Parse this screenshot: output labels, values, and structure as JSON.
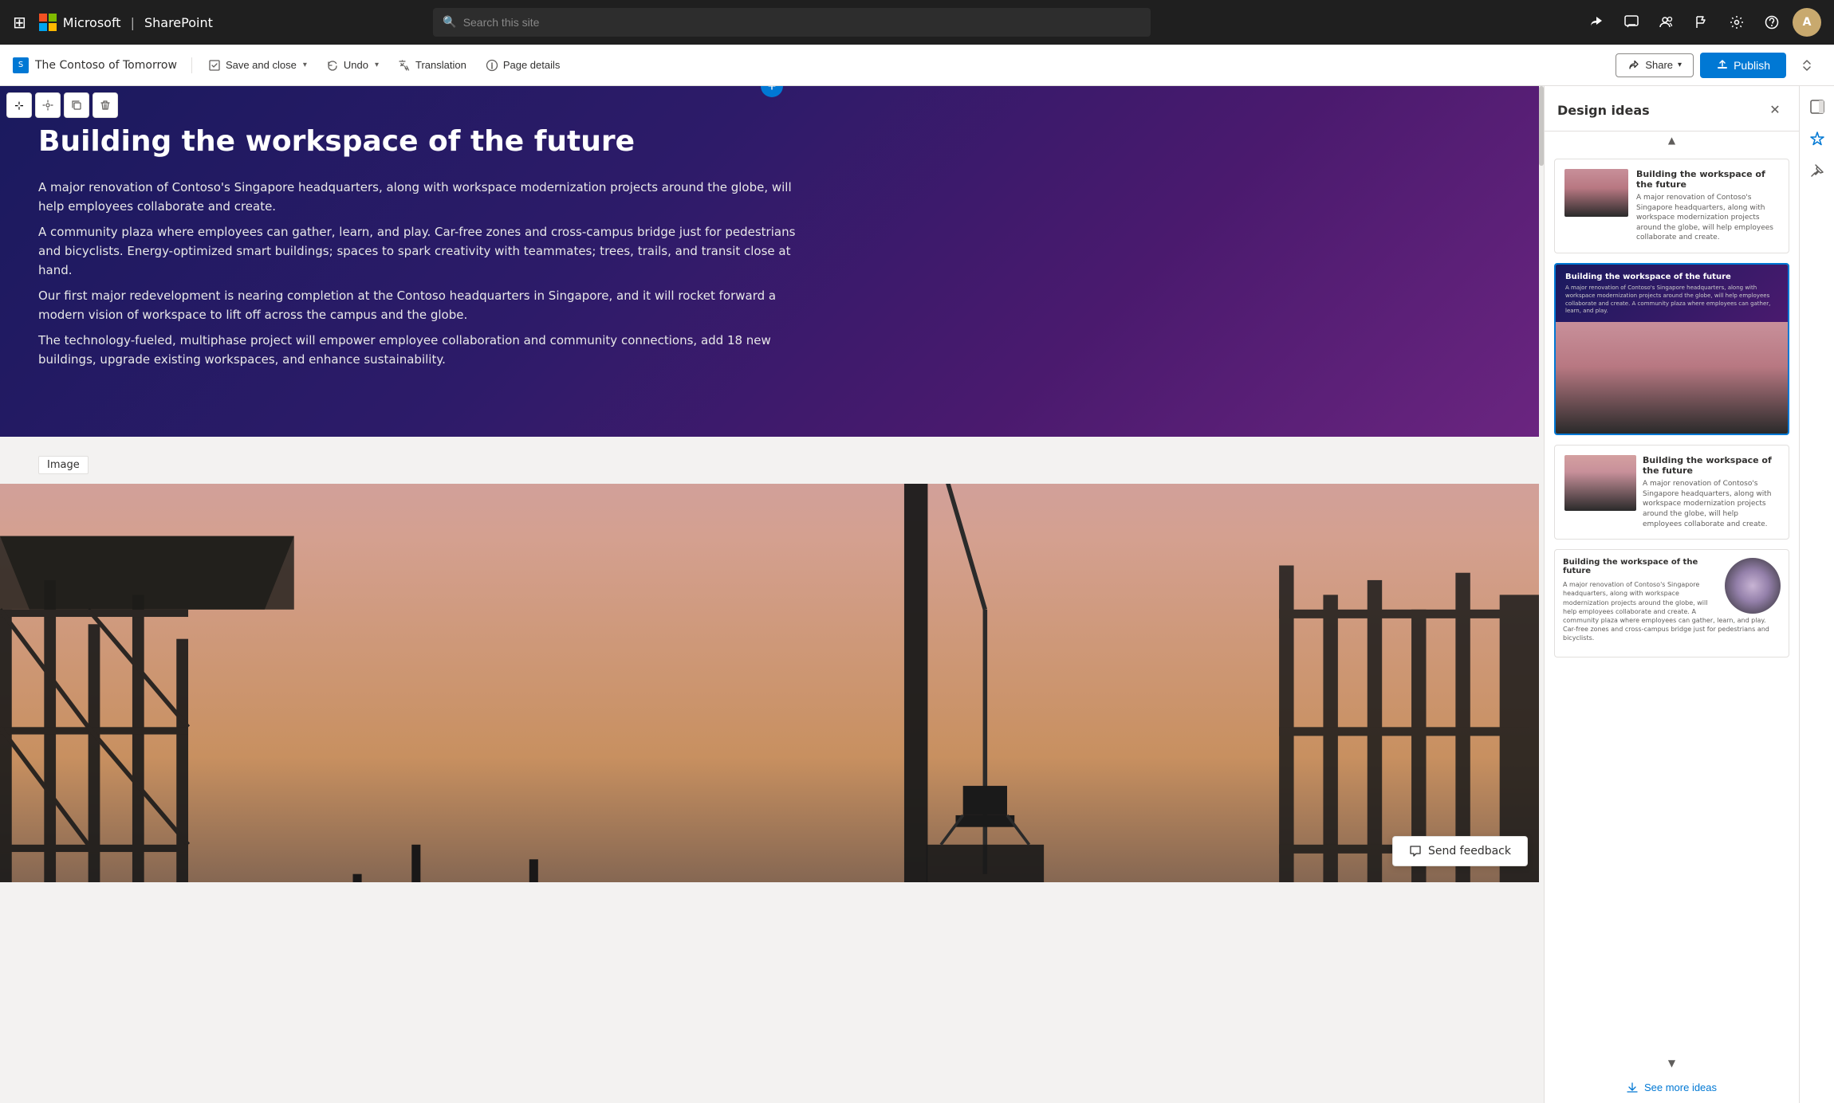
{
  "nav": {
    "apps_icon": "⊞",
    "company": "Microsoft",
    "app": "SharePoint",
    "search_placeholder": "Search this site",
    "icons": [
      "💬",
      "👥",
      "⚑",
      "⚙",
      "?"
    ],
    "avatar_initials": "A"
  },
  "toolbar": {
    "brand_icon": "S",
    "brand_name": "The Contoso of Tomorrow",
    "save_close": "Save and close",
    "undo": "Undo",
    "translation": "Translation",
    "page_details": "Page details",
    "share": "Share",
    "publish": "Publish"
  },
  "hero": {
    "title": "Building the workspace of the future",
    "paragraph1": "A major renovation of Contoso's Singapore headquarters, along with workspace modernization projects around the globe, will help employees collaborate and create.",
    "paragraph2": "A community plaza where employees can gather, learn, and play. Car-free zones and cross-campus bridge just for pedestrians and bicyclists. Energy-optimized smart buildings; spaces to spark creativity with teammates; trees, trails, and transit close at hand.",
    "paragraph3": "Our first major redevelopment is nearing completion at the Contoso headquarters in Singapore, and it will rocket forward a modern vision of workspace to lift off across the campus and the globe.",
    "paragraph4": "The technology-fueled, multiphase project will empower employee collaboration and community connections, add 18 new buildings, upgrade existing workspaces, and enhance sustainability."
  },
  "image_label": "Image",
  "send_feedback": "Send feedback",
  "design_ideas": {
    "title": "Design ideas",
    "see_more": "See more ideas",
    "card1": {
      "title": "Building the workspace of the future",
      "body": "A major renovation of Contoso's Singapore headquarters, along with workspace modernization projects around the globe, will help employees collaborate and create."
    },
    "card2": {
      "title": "Building the workspace of the future",
      "body": "A major renovation of Contoso's Singapore headquarters, along with workspace modernization projects around the globe, will help employees collaborate and create. A community plaza where employees can gather, learn, and play."
    },
    "card3": {
      "title": "Building the workspace of the future",
      "body": "A major renovation of Contoso's Singapore headquarters, along with workspace modernization projects around the globe, will help employees collaborate and create."
    },
    "card4": {
      "title": "Building the workspace of the future",
      "body": "A major renovation of Contoso's Singapore headquarters, along with workspace modernization projects around the globe, will help employees collaborate and create. A community plaza where employees can gather, learn, and play. Car-free zones and cross-campus bridge just for pedestrians and bicyclists."
    }
  }
}
